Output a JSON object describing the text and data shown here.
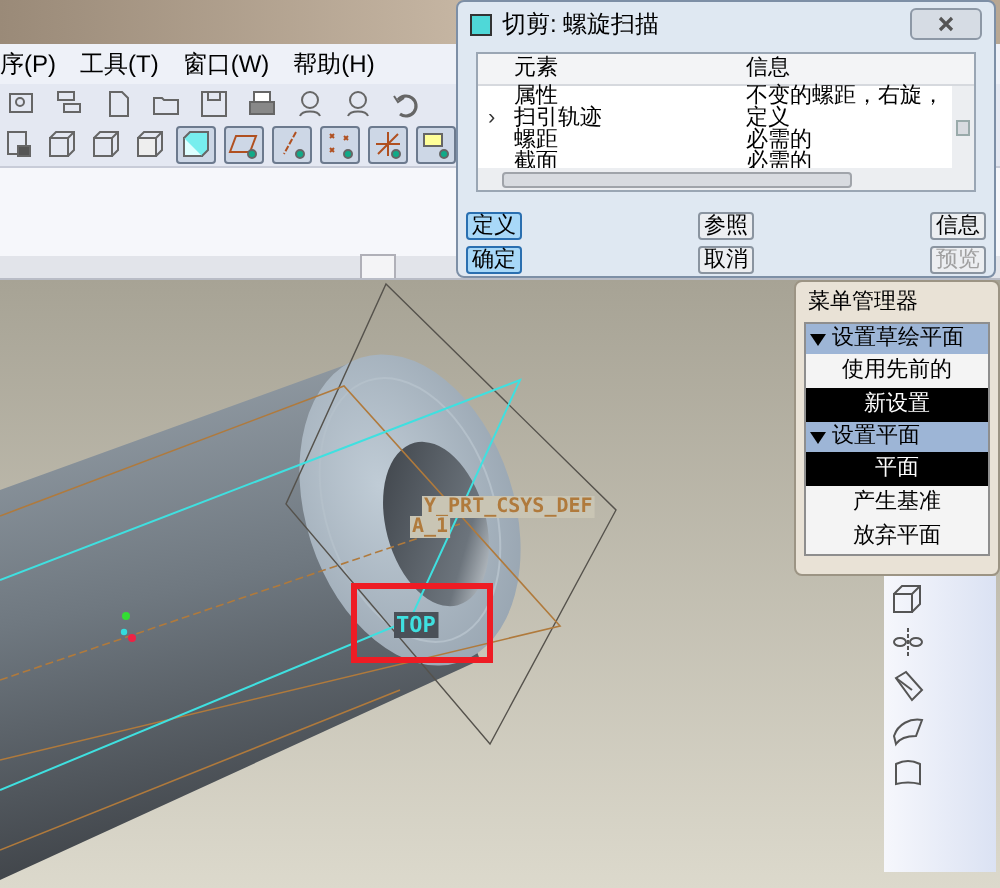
{
  "menu_bar": [
    {
      "label": "序(P)"
    },
    {
      "label": "工具(T)"
    },
    {
      "label": "窗口(W)"
    },
    {
      "label": "帮助(H)"
    }
  ],
  "viewport": {
    "labels": [
      {
        "text": "Y_PRT_CSYS_DEF",
        "kind": "csys"
      },
      {
        "text": "A_1",
        "kind": "axis"
      },
      {
        "text": "TOP",
        "kind": "plane"
      }
    ]
  },
  "dialog": {
    "title": "切剪: 螺旋扫描",
    "columns": [
      "元素",
      "信息"
    ],
    "rows": [
      {
        "element": "属性",
        "info": "不变的螺距，右旋，"
      },
      {
        "element": "扫引轨迹",
        "info": "定义",
        "marker": "›"
      },
      {
        "element": "螺距",
        "info": "必需的"
      },
      {
        "element": "截面",
        "info": "必需的"
      }
    ],
    "buttons": [
      {
        "label": "定义",
        "kind": "left",
        "focused": true,
        "disabled": false
      },
      {
        "label": "参照",
        "kind": "middle",
        "focused": false,
        "disabled": false
      },
      {
        "label": "信息",
        "kind": "right",
        "focused": false,
        "disabled": false
      },
      {
        "label": "确定",
        "kind": "left",
        "focused": true,
        "disabled": false
      },
      {
        "label": "取消",
        "kind": "middle",
        "focused": false,
        "disabled": false
      },
      {
        "label": "预览",
        "kind": "right",
        "focused": false,
        "disabled": true
      }
    ]
  },
  "menu_manager": {
    "title": "菜单管理器",
    "sections": [
      {
        "label": "设置草绘平面",
        "expanded": true,
        "items": [
          {
            "label": "使用先前的",
            "selected": false
          },
          {
            "label": "新设置",
            "selected": true
          }
        ]
      },
      {
        "label": "设置平面",
        "expanded": true,
        "items": [
          {
            "label": "平面",
            "selected": true
          },
          {
            "label": "产生基准",
            "selected": false
          },
          {
            "label": "放弃平面",
            "selected": false
          }
        ]
      }
    ]
  }
}
